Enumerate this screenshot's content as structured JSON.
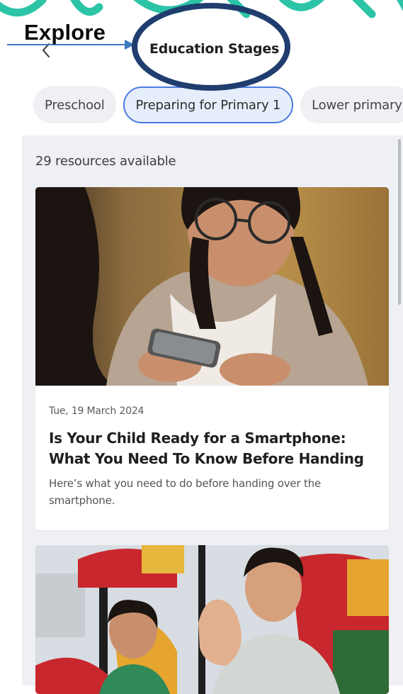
{
  "annotation": {
    "label": "Explore",
    "arrow_color": "#3f79c2",
    "highlight_color": "#1f3d6e"
  },
  "header": {
    "back_icon": "chevron-left-icon",
    "title": "Education Stages"
  },
  "tabs": [
    {
      "label": "Preschool",
      "active": false
    },
    {
      "label": "Preparing for Primary 1",
      "active": true
    },
    {
      "label": "Lower primary",
      "active": false
    }
  ],
  "content": {
    "resource_count": "29 resources available",
    "cards": [
      {
        "image": "girl-with-smartphone-photo",
        "date": "Tue, 19 March 2024",
        "title": "Is Your Child Ready for a Smartphone: What You Need To Know Before Handing Over th…",
        "description": "Here’s what you need to do before handing over the smartphone."
      },
      {
        "image": "people-waving-at-playground-photo"
      }
    ]
  },
  "colors": {
    "accent": "#4a7be0",
    "active_tab_bg": "#e6eefb",
    "tab_bg": "#eef0f3",
    "panel_bg": "#eef0f4",
    "decor_teal": "#2bc4a6"
  }
}
